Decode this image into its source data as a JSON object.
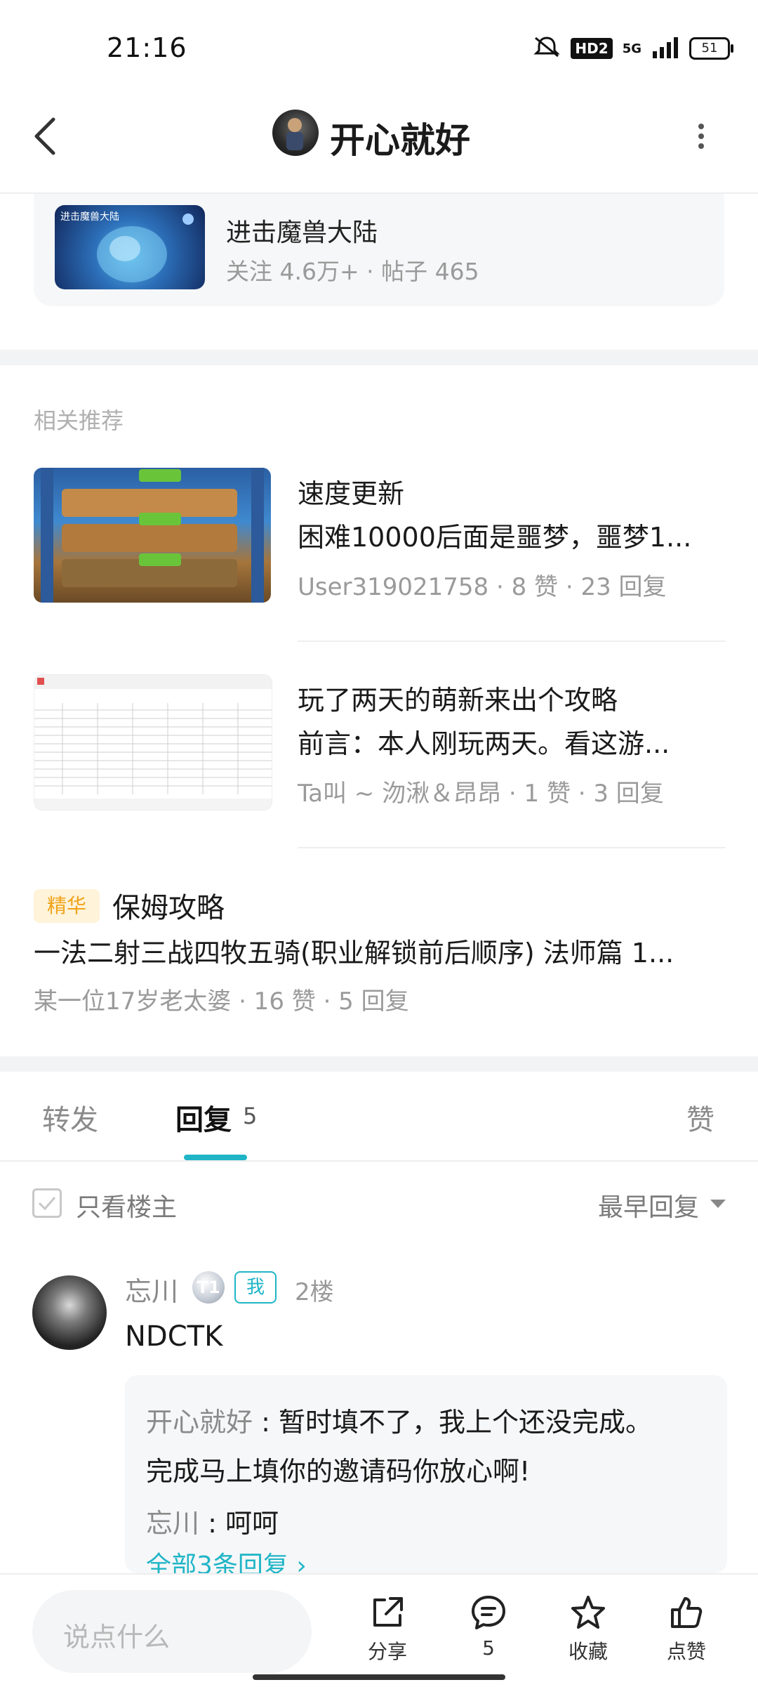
{
  "status_bar": {
    "time": "21:16",
    "hd_badge": "HD2",
    "network": "5G",
    "battery": "51"
  },
  "header": {
    "title": "开心就好"
  },
  "forum": {
    "thumb_text": "进击魔兽大陆",
    "name": "进击魔兽大陆",
    "meta": "关注 4.6万+ · 帖子 465"
  },
  "recommendations": {
    "heading": "相关推荐",
    "items": [
      {
        "title": "速度更新",
        "subtitle": "困难10000后面是噩梦，噩梦1...",
        "meta": "User319021758 · 8 赞 · 23 回复"
      },
      {
        "title": "玩了两天的萌新来出个攻略",
        "subtitle": "前言：本人刚玩两天。看这游...",
        "meta": "Ta叫 ~ 沕湫＆昂昂 · 1 赞 · 3 回复"
      }
    ],
    "featured": {
      "badge": "精华",
      "title": "保姆攻略",
      "subtitle": "一法二射三战四牧五骑(职业解锁前后顺序) 法师篇 1...",
      "meta": "某一位17岁老太婆 · 16 赞 · 5 回复"
    }
  },
  "tabs": {
    "forward": "转发",
    "reply": "回复",
    "reply_count": "5",
    "like": "赞"
  },
  "filter": {
    "only_op": "只看楼主",
    "sort": "最早回复"
  },
  "reply": {
    "name": "忘川",
    "level_badge": "T1",
    "me_badge": "我",
    "floor": "2楼",
    "content": "NDCTK",
    "sub_replies": [
      {
        "name": "开心就好",
        "sep": " : ",
        "text": "暂时填不了，我上个还没完成。"
      },
      {
        "name": "",
        "sep": "",
        "text": "完成马上填你的邀请码你放心啊!"
      },
      {
        "name": "忘川",
        "sep": " : ",
        "text": "呵呵"
      }
    ],
    "more": "全部3条回复 ›"
  },
  "bottom_bar": {
    "input_placeholder": "说点什么",
    "share": "分享",
    "comments": "5",
    "favorite": "收藏",
    "like": "点赞"
  }
}
